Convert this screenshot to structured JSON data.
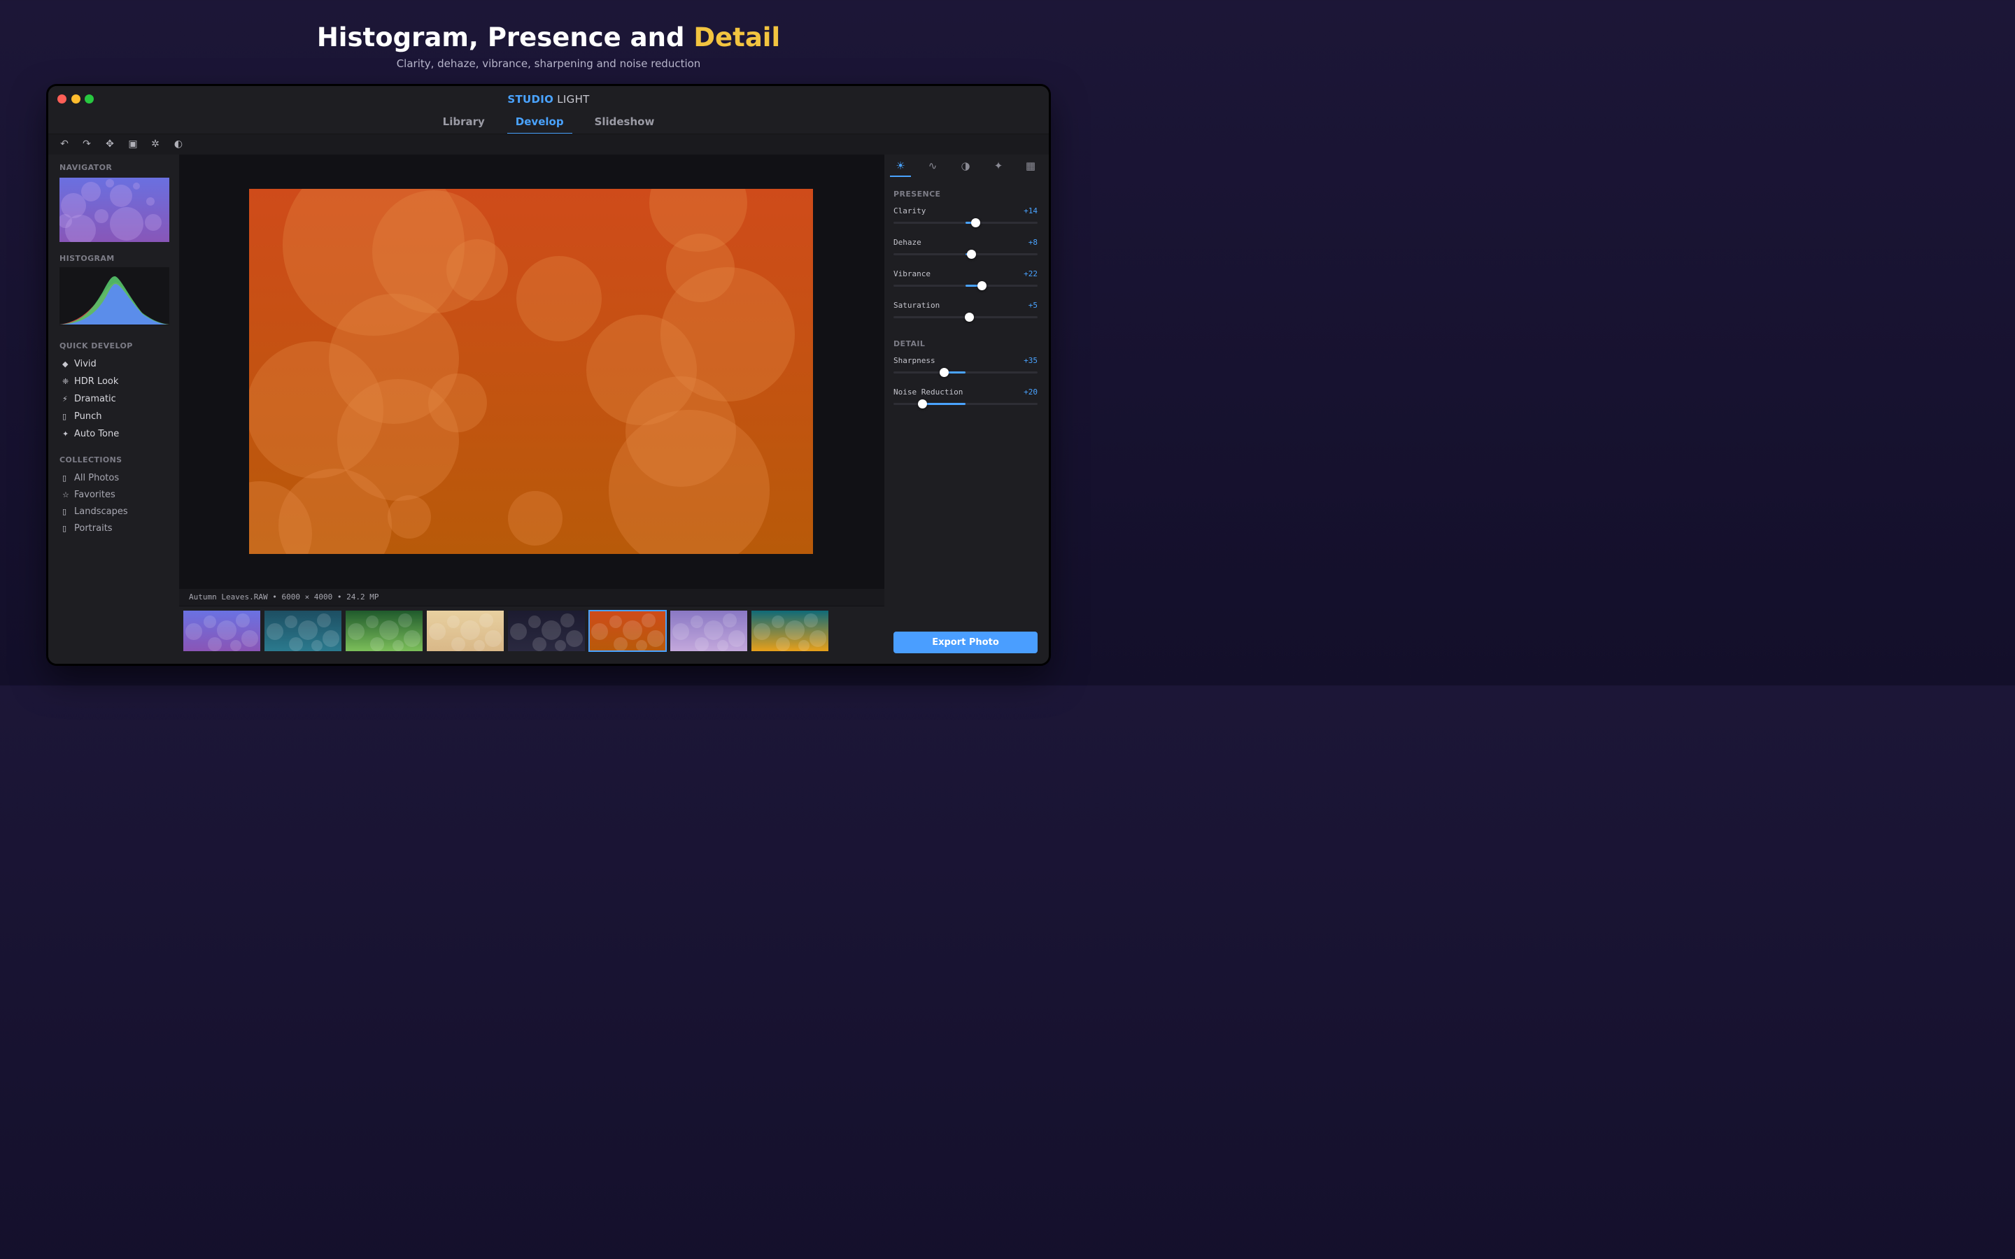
{
  "hero": {
    "title_main": "Histogram, Presence and ",
    "title_accent": "Detail",
    "subtitle": "Clarity, dehaze, vibrance, sharpening and noise reduction"
  },
  "app": {
    "brand_primary": "STUDIO",
    "brand_secondary": "LIGHT",
    "modules": [
      "Library",
      "Develop",
      "Slideshow"
    ],
    "active_module": "Develop"
  },
  "toolbar": {
    "tools": [
      {
        "name": "undo-icon",
        "glyph": "↶"
      },
      {
        "name": "redo-icon",
        "glyph": "↷"
      },
      {
        "name": "move-icon",
        "glyph": "✥"
      },
      {
        "name": "crop-icon",
        "glyph": "▣"
      },
      {
        "name": "spot-heal-icon",
        "glyph": "✲"
      },
      {
        "name": "mask-icon",
        "glyph": "◐"
      }
    ]
  },
  "left_panel": {
    "navigator_label": "NAVIGATOR",
    "histogram_label": "HISTOGRAM",
    "quick_develop_label": "QUICK DEVELOP",
    "quick_develop": [
      {
        "icon": "◆",
        "icon_name": "diamond-icon",
        "label": "Vivid"
      },
      {
        "icon": "❈",
        "icon_name": "sparkle-icon",
        "label": "HDR Look"
      },
      {
        "icon": "⚡",
        "icon_name": "lightning-icon",
        "label": "Dramatic"
      },
      {
        "icon": "▯",
        "icon_name": "placeholder-icon",
        "label": "Punch"
      },
      {
        "icon": "✦",
        "icon_name": "star-icon",
        "label": "Auto Tone"
      }
    ],
    "collections_label": "COLLECTIONS",
    "collections": [
      {
        "icon": "▯",
        "icon_name": "folder-icon",
        "label": "All Photos"
      },
      {
        "icon": "☆",
        "icon_name": "star-outline-icon",
        "label": "Favorites"
      },
      {
        "icon": "▯",
        "icon_name": "folder-icon",
        "label": "Landscapes"
      },
      {
        "icon": "▯",
        "icon_name": "folder-icon",
        "label": "Portraits"
      }
    ]
  },
  "photo": {
    "info": "Autumn Leaves.RAW • 6000 × 4000 • 24.2 MP"
  },
  "filmstrip": {
    "selected_index": 5,
    "thumbs": [
      {
        "top": "#6a72e2",
        "bottom": "#8a55b6"
      },
      {
        "top": "#1d4e62",
        "bottom": "#2b7a8e"
      },
      {
        "top": "#1f5a2c",
        "bottom": "#7cbf5a"
      },
      {
        "top": "#e8d0a0",
        "bottom": "#d9b888"
      },
      {
        "top": "#1c1b30",
        "bottom": "#2a2940"
      },
      {
        "top": "#cf4b1a",
        "bottom": "#b85a09"
      },
      {
        "top": "#8978c4",
        "bottom": "#c3a8dc"
      },
      {
        "top": "#0f6a78",
        "bottom": "#e8a01a"
      }
    ]
  },
  "right_panel": {
    "tabs": [
      {
        "name": "basic-tab-icon",
        "glyph": "☀"
      },
      {
        "name": "curve-tab-icon",
        "glyph": "∿"
      },
      {
        "name": "color-tab-icon",
        "glyph": "◑"
      },
      {
        "name": "effects-tab-icon",
        "glyph": "✦"
      },
      {
        "name": "detail-grid-tab-icon",
        "glyph": "▦"
      }
    ],
    "active_tab": 0,
    "presence_label": "PRESENCE",
    "detail_label": "DETAIL",
    "presence": [
      {
        "label": "Clarity",
        "value": "+14",
        "level": 0.57
      },
      {
        "label": "Dehaze",
        "value": "+8",
        "level": 0.54
      },
      {
        "label": "Vibrance",
        "value": "+22",
        "level": 0.61
      },
      {
        "label": "Saturation",
        "value": "+5",
        "level": 0.525
      }
    ],
    "detail": [
      {
        "label": "Sharpness",
        "value": "+35",
        "level": 0.35
      },
      {
        "label": "Noise Reduction",
        "value": "+20",
        "level": 0.2
      }
    ],
    "export_label": "Export Photo"
  },
  "colors": {
    "accent": "#4aa3ff",
    "title_accent": "#f2c440",
    "histogram_red": "#e25050",
    "histogram_green": "#55c46a",
    "histogram_blue": "#5b8dea"
  }
}
